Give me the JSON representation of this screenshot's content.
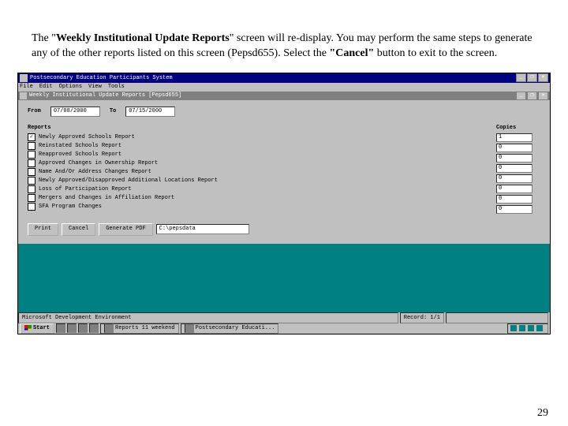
{
  "instruction": {
    "part1": "The \"",
    "bold1": "Weekly Institutional Update Reports",
    "part2": "\" screen will re-display.  You may perform the same steps to generate any of the other reports listed on this screen (Pepsd655).  Select the ",
    "bold2": "\"Cancel\"",
    "part3": " button to exit to the screen."
  },
  "outer": {
    "title": "Postsecondary Education Participants System",
    "min": "_",
    "max": "❐",
    "close": "✕"
  },
  "menu": {
    "items": [
      "File",
      "Edit",
      "Options",
      "View",
      "Tools"
    ]
  },
  "inner": {
    "title": "Weekly Institutional Update Reports [Pepsd655]",
    "min": "_",
    "max": "❐",
    "close": "✕"
  },
  "dates": {
    "from_label": "From",
    "from_value": "07/08/2000",
    "to_label": "To",
    "to_value": "07/15/2000"
  },
  "reports": {
    "heading": "Reports",
    "copies_heading": "Copies",
    "rows": [
      {
        "checked": true,
        "label": "Newly Approved Schools Report",
        "copies": "1"
      },
      {
        "checked": false,
        "label": "Reinstated Schools Report",
        "copies": "0"
      },
      {
        "checked": false,
        "label": "Reapproved Schools Report",
        "copies": "0"
      },
      {
        "checked": false,
        "label": "Approved Changes in Ownership Report",
        "copies": "0"
      },
      {
        "checked": false,
        "label": "Name And/Or Address Changes Report",
        "copies": "0"
      },
      {
        "checked": false,
        "label": "Newly Approved/Disapproved Additional Locations Report",
        "copies": "0"
      },
      {
        "checked": false,
        "label": "Loss of Participation Report",
        "copies": "0"
      },
      {
        "checked": false,
        "label": "Mergers and Changes in Affiliation Report",
        "copies": "0"
      },
      {
        "checked": false,
        "label": "SFA Program Changes",
        "copies": ""
      }
    ]
  },
  "buttons": {
    "print": "Print",
    "cancel": "Cancel",
    "generate": "Generate PDF"
  },
  "path": "C:\\pepsdata",
  "status": {
    "hint": "Microsoft Development Environment",
    "record": "Record: 1/1"
  },
  "taskbar": {
    "start": "Start",
    "app1": "Reports 11 weekend",
    "app2": "Postsecondary Educati..."
  },
  "tray": {
    "time": ""
  },
  "page_number": "29"
}
